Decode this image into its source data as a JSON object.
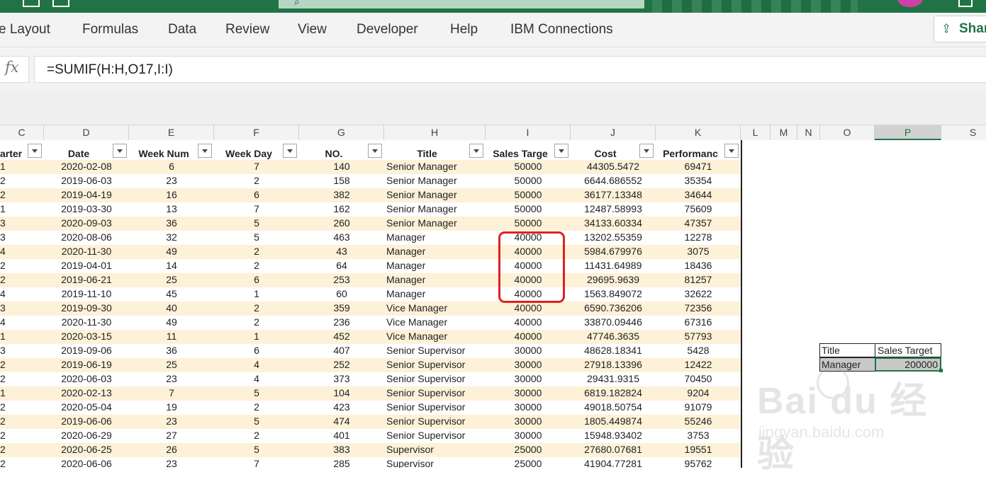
{
  "titlebar": {
    "search_text": "⌕"
  },
  "ribbon": {
    "tabs": [
      "e Layout",
      "Formulas",
      "Data",
      "Review",
      "View",
      "Developer",
      "Help",
      "IBM Connections"
    ],
    "share_label": "Shar"
  },
  "formula_bar": {
    "fx_label": "fx",
    "formula": "=SUMIF(H:H,O17,I:I)"
  },
  "column_letters": [
    "C",
    "D",
    "E",
    "F",
    "G",
    "H",
    "I",
    "J",
    "K",
    "L",
    "M",
    "N",
    "O",
    "P",
    "S"
  ],
  "selected_column": "P",
  "table_headers": [
    "arter",
    "Date",
    "Week Num",
    "Week Day",
    "NO.",
    "Title",
    "Sales Targe",
    "Cost",
    "Performanc"
  ],
  "rows": [
    [
      "1",
      "2020-02-08",
      "6",
      "7",
      "140",
      "Senior Manager",
      "50000",
      "44305.5472",
      "69471"
    ],
    [
      "2",
      "2019-06-03",
      "23",
      "2",
      "158",
      "Senior Manager",
      "50000",
      "6644.686552",
      "35354"
    ],
    [
      "2",
      "2019-04-19",
      "16",
      "6",
      "382",
      "Senior Manager",
      "50000",
      "36177.13348",
      "34644"
    ],
    [
      "1",
      "2019-03-30",
      "13",
      "7",
      "162",
      "Senior Manager",
      "50000",
      "12487.58993",
      "75609"
    ],
    [
      "3",
      "2020-09-03",
      "36",
      "5",
      "260",
      "Senior Manager",
      "50000",
      "34133.60334",
      "47357"
    ],
    [
      "3",
      "2020-08-06",
      "32",
      "5",
      "463",
      "Manager",
      "40000",
      "13202.55359",
      "12278"
    ],
    [
      "4",
      "2020-11-30",
      "49",
      "2",
      "43",
      "Manager",
      "40000",
      "5984.679976",
      "3075"
    ],
    [
      "2",
      "2019-04-01",
      "14",
      "2",
      "64",
      "Manager",
      "40000",
      "11431.64989",
      "18436"
    ],
    [
      "2",
      "2019-06-21",
      "25",
      "6",
      "253",
      "Manager",
      "40000",
      "29695.9639",
      "81257"
    ],
    [
      "4",
      "2019-11-10",
      "45",
      "1",
      "60",
      "Manager",
      "40000",
      "1563.849072",
      "32622"
    ],
    [
      "3",
      "2019-09-30",
      "40",
      "2",
      "359",
      "Vice Manager",
      "40000",
      "6590.736206",
      "72356"
    ],
    [
      "4",
      "2020-11-30",
      "49",
      "2",
      "236",
      "Vice Manager",
      "40000",
      "33870.09446",
      "67316"
    ],
    [
      "1",
      "2020-03-15",
      "11",
      "1",
      "452",
      "Vice Manager",
      "40000",
      "47746.3635",
      "57793"
    ],
    [
      "3",
      "2019-09-06",
      "36",
      "6",
      "407",
      "Senior Supervisor",
      "30000",
      "48628.18341",
      "5428"
    ],
    [
      "2",
      "2019-06-19",
      "25",
      "4",
      "252",
      "Senior Supervisor",
      "30000",
      "27918.13396",
      "12422"
    ],
    [
      "2",
      "2020-06-03",
      "23",
      "4",
      "373",
      "Senior Supervisor",
      "30000",
      "29431.9315",
      "70450"
    ],
    [
      "1",
      "2020-02-13",
      "7",
      "5",
      "104",
      "Senior Supervisor",
      "30000",
      "6819.182824",
      "9204"
    ],
    [
      "2",
      "2020-05-04",
      "19",
      "2",
      "423",
      "Senior Supervisor",
      "30000",
      "49018.50754",
      "91079"
    ],
    [
      "2",
      "2019-06-06",
      "23",
      "5",
      "474",
      "Senior Supervisor",
      "30000",
      "1805.449874",
      "55246"
    ],
    [
      "2",
      "2020-06-29",
      "27",
      "2",
      "401",
      "Senior Supervisor",
      "30000",
      "15948.93402",
      "3753"
    ],
    [
      "2",
      "2020-06-25",
      "26",
      "5",
      "383",
      "Supervisor",
      "25000",
      "27680.07681",
      "19551"
    ],
    [
      "2",
      "2020-06-06",
      "23",
      "7",
      "285",
      "Supervisor",
      "25000",
      "41904.77281",
      "95762"
    ]
  ],
  "summary": {
    "title_header": "Title",
    "target_header": "Sales Target",
    "title_value": "Manager",
    "target_value": "200000"
  },
  "watermark": {
    "brand": "Bai du 经验",
    "url": "jingyan.baidu.com"
  },
  "colors": {
    "excel_green": "#217346",
    "band": "#fdf1d8",
    "highlight": "#e02020"
  }
}
